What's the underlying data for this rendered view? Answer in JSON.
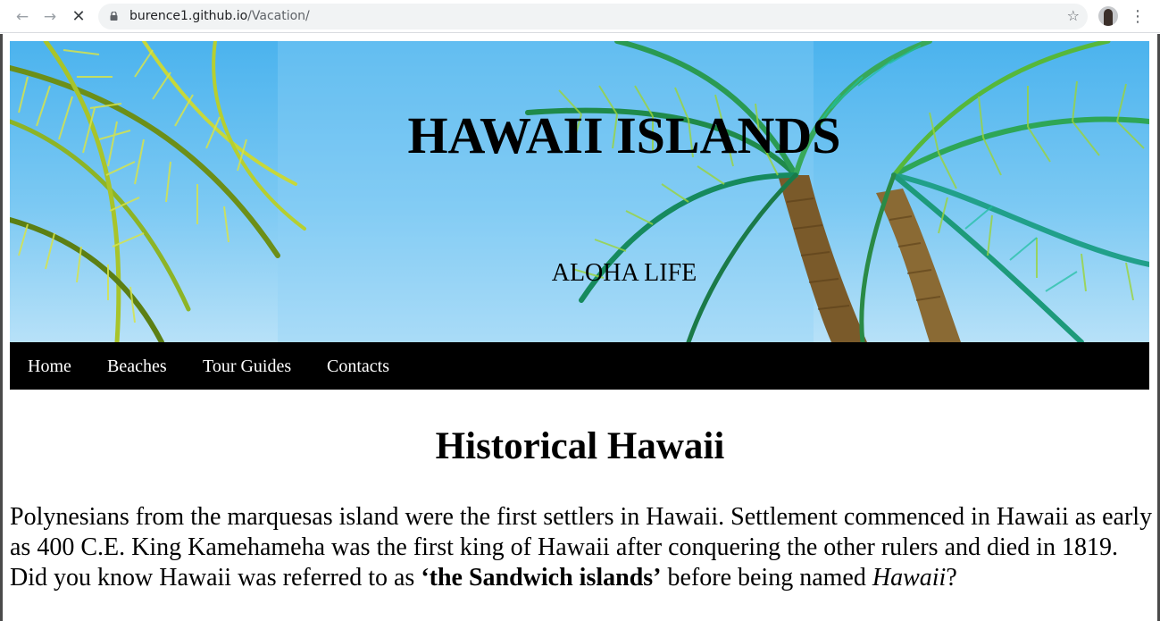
{
  "browser": {
    "url_host": "burence1.github.io",
    "url_path": "/Vacation/",
    "icons": {
      "back": "arrow-left-icon",
      "forward": "arrow-right-icon",
      "stop": "close-icon",
      "lock": "lock-icon",
      "bookmark": "star-icon",
      "profile": "avatar",
      "menu": "more-vertical-icon"
    }
  },
  "hero": {
    "title": "HAWAII ISLANDS",
    "subtitle": "ALOHA LIFE"
  },
  "nav": {
    "items": [
      {
        "label": "Home"
      },
      {
        "label": "Beaches"
      },
      {
        "label": "Tour Guides"
      },
      {
        "label": "Contacts"
      }
    ]
  },
  "main": {
    "heading": "Historical Hawaii",
    "paragraph_part1": "Polynesians from the marquesas island were the first settlers in Hawaii. Settlement commenced in Hawaii as early as 400 C.E. King Kamehameha was the first king of Hawaii after conquering the other rulers and died in 1819. Did you know Hawaii was referred to as ",
    "paragraph_bold": "‘the Sandwich islands’",
    "paragraph_part2": " before being named ",
    "paragraph_italic": "Hawaii",
    "paragraph_end": "?"
  },
  "colors": {
    "nav_background": "#000000",
    "nav_text": "#ffffff",
    "sky": "#4bb3ee"
  }
}
